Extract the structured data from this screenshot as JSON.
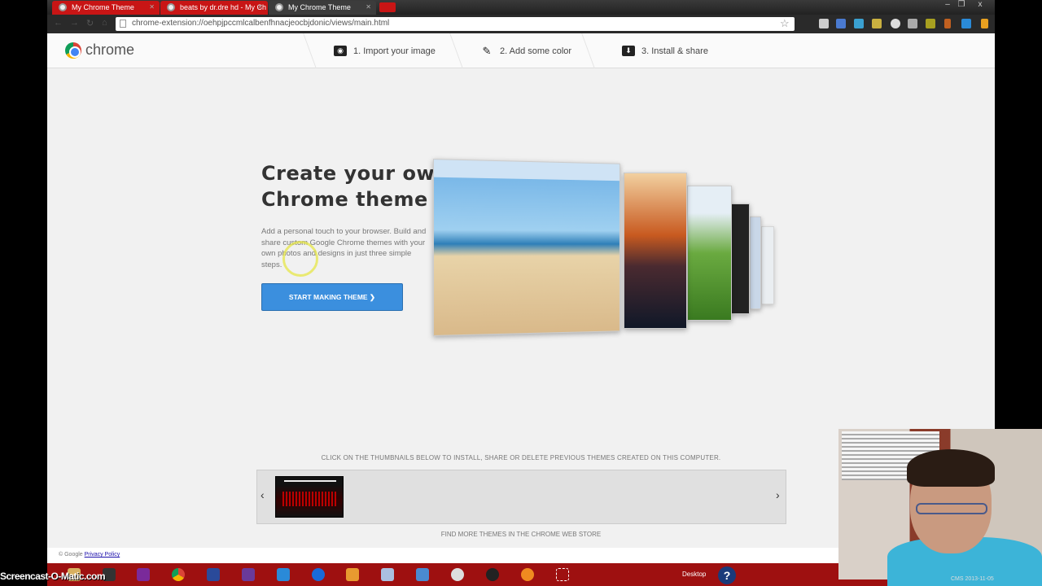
{
  "browser": {
    "tabs": [
      {
        "title": "My Chrome Theme",
        "active": false
      },
      {
        "title": "beats by dr.dre hd - My Ch",
        "active": false
      },
      {
        "title": "My Chrome Theme",
        "active": true
      }
    ],
    "url": "chrome-extension://oehpjpccmlcalbenfhnacjeocbjdonic/views/main.html",
    "window_controls": {
      "minimize": "–",
      "restore": "❐",
      "close": "x"
    }
  },
  "header": {
    "logo_text": "chrome",
    "steps": [
      {
        "icon": "camera-icon",
        "label": "1. Import your image"
      },
      {
        "icon": "brush-icon",
        "label": "2. Add some color"
      },
      {
        "icon": "download-folder-icon",
        "label": "3. Install & share"
      }
    ]
  },
  "hero": {
    "title_line1": "Create your own",
    "title_line2": "Chrome theme",
    "description": "Add a personal touch to your browser. Build and share custom Google Chrome themes with your own photos and designs in just three simple steps.",
    "cta_label": "START MAKING THEME ❯"
  },
  "previous": {
    "instruction": "CLICK ON THE THUMBNAILS BELOW TO INSTALL, SHARE OR DELETE PREVIOUS THEMES CREATED ON THIS COMPUTER.",
    "prev_arrow": "‹",
    "next_arrow": "›",
    "find_more": "FIND MORE THEMES IN THE CHROME WEB STORE"
  },
  "footer": {
    "copyright": "© Google",
    "privacy": "Privacy Policy"
  },
  "taskbar": {
    "desktop_label": "Desktop",
    "help": "?",
    "clock": "CMS   2013-11-05"
  },
  "watermark": "Screencast-O-Matic.com",
  "colors": {
    "tab_red": "#c81515",
    "cta_blue": "#3b8fde",
    "taskbar_red": "#9e1010"
  }
}
